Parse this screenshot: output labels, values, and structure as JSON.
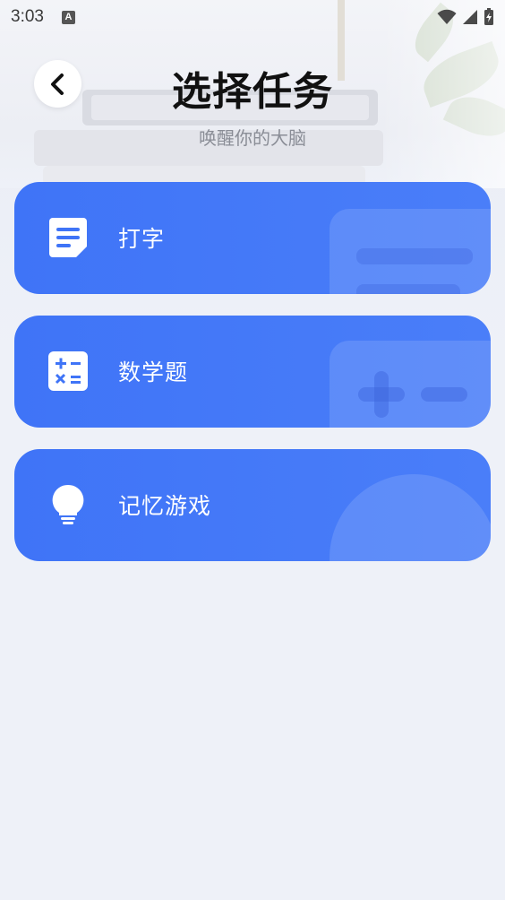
{
  "status_bar": {
    "time": "3:03",
    "notification_icon": "a-icon",
    "right_icons": [
      "wifi-icon",
      "signal-icon",
      "battery-charging-icon"
    ]
  },
  "header": {
    "back_icon": "chevron-left-icon",
    "title": "选择任务",
    "subtitle": "唤醒你的大脑"
  },
  "tasks": [
    {
      "label": "打字",
      "icon": "document-lines-icon"
    },
    {
      "label": "数学题",
      "icon": "calculator-icon"
    },
    {
      "label": "记忆游戏",
      "icon": "lightbulb-icon"
    }
  ],
  "colors": {
    "card_blue": "#3f74f7",
    "background": "#eef1f8",
    "title": "#111111",
    "subtitle": "#8a8d96"
  }
}
